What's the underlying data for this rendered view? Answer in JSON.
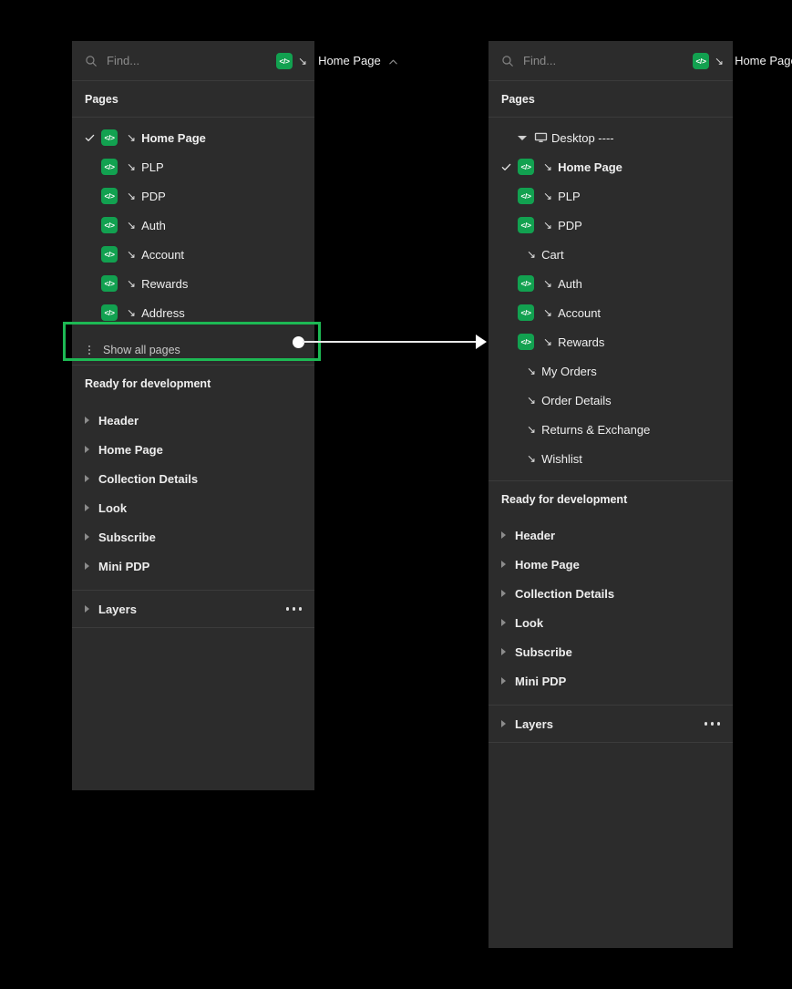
{
  "search": {
    "placeholder": "Find...",
    "value": "",
    "icon": "search-icon"
  },
  "header": {
    "current_page": "Home Page",
    "badge_icon": "code-icon",
    "badge_label": "</>",
    "arrow_glyph": "↘",
    "collapse_icon": "chevron-up-icon"
  },
  "sections": {
    "pages_label": "Pages",
    "ready_label": "Ready for development",
    "layers_label": "Layers",
    "overflow_icon": "more-options-icon"
  },
  "left_panel": {
    "pages": [
      {
        "label": "Home Page",
        "icon": "code-icon",
        "checked": true,
        "arrow": "↘"
      },
      {
        "label": "PLP",
        "icon": "code-icon",
        "checked": false,
        "arrow": "↘"
      },
      {
        "label": "PDP",
        "icon": "code-icon",
        "checked": false,
        "arrow": "↘"
      },
      {
        "label": "Auth",
        "icon": "code-icon",
        "checked": false,
        "arrow": "↘"
      },
      {
        "label": "Account",
        "icon": "code-icon",
        "checked": false,
        "arrow": "↘"
      },
      {
        "label": "Rewards",
        "icon": "code-icon",
        "checked": false,
        "arrow": "↘"
      },
      {
        "label": "Address",
        "icon": "code-icon",
        "checked": false,
        "arrow": "↘"
      }
    ],
    "show_all": {
      "label": "Show all pages",
      "handle_icon": "drag-handle-icon"
    },
    "dev_items": [
      {
        "label": "Header"
      },
      {
        "label": "Home Page"
      },
      {
        "label": "Collection Details"
      },
      {
        "label": "Look"
      },
      {
        "label": "Subscribe"
      },
      {
        "label": "Mini PDP"
      }
    ]
  },
  "right_panel": {
    "group": {
      "label": "Desktop ----",
      "icon": "monitor-icon",
      "disclosure_icon": "triangle-down-icon"
    },
    "pages": [
      {
        "label": "Home Page",
        "icon": "code-icon",
        "checked": true,
        "arrow": "↘"
      },
      {
        "label": "PLP",
        "icon": "code-icon",
        "checked": false,
        "arrow": "↘"
      },
      {
        "label": "PDP",
        "icon": "code-icon",
        "checked": false,
        "arrow": "↘"
      },
      {
        "label": "Cart",
        "icon": null,
        "checked": false,
        "arrow": "↘"
      },
      {
        "label": "Auth",
        "icon": "code-icon",
        "checked": false,
        "arrow": "↘"
      },
      {
        "label": "Account",
        "icon": "code-icon",
        "checked": false,
        "arrow": "↘"
      },
      {
        "label": "Rewards",
        "icon": "code-icon",
        "checked": false,
        "arrow": "↘"
      },
      {
        "label": "My Orders",
        "icon": null,
        "checked": false,
        "arrow": "↘"
      },
      {
        "label": "Order Details",
        "icon": null,
        "checked": false,
        "arrow": "↘"
      },
      {
        "label": "Returns & Exchange",
        "icon": null,
        "checked": false,
        "arrow": "↘"
      },
      {
        "label": "Wishlist",
        "icon": null,
        "checked": false,
        "arrow": "↘"
      }
    ],
    "dev_items": [
      {
        "label": "Header"
      },
      {
        "label": "Home Page"
      },
      {
        "label": "Collection Details"
      },
      {
        "label": "Look"
      },
      {
        "label": "Subscribe"
      },
      {
        "label": "Mini PDP"
      }
    ]
  },
  "annotation": {
    "highlight_color": "#1db954",
    "connector_color": "#ffffff",
    "target": "Show all pages"
  },
  "colors": {
    "panel_bg": "#2c2c2c",
    "accent_green": "#12a150",
    "divider": "#3b3b3b",
    "page_bg": "#000000"
  }
}
